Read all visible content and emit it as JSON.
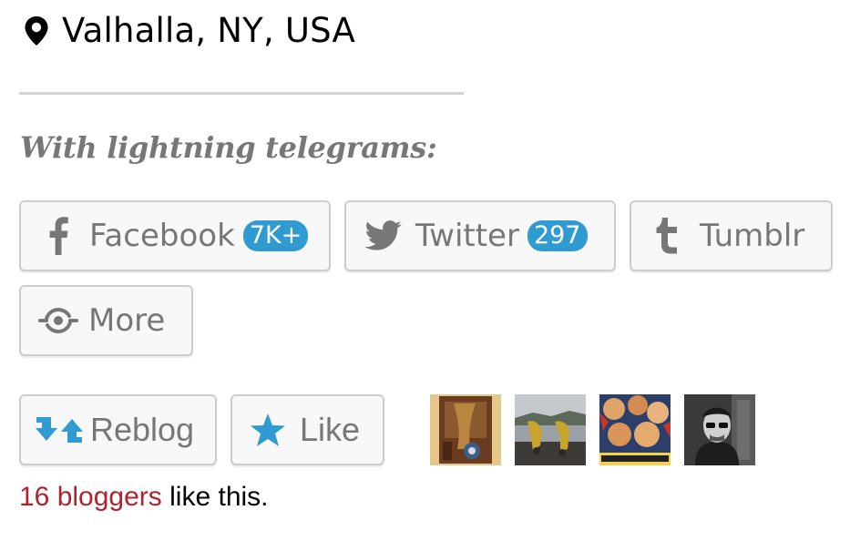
{
  "location": {
    "text": "Valhalla, NY, USA",
    "icon": "map-pin-icon"
  },
  "share": {
    "heading": "With lightning telegrams:",
    "buttons": {
      "facebook": {
        "label": "Facebook",
        "count": "7K+",
        "icon": "facebook-icon"
      },
      "twitter": {
        "label": "Twitter",
        "count": "297",
        "icon": "twitter-bird-icon"
      },
      "tumblr": {
        "label": "Tumblr",
        "icon": "tumblr-icon"
      },
      "more": {
        "label": "More",
        "icon": "share-more-icon"
      }
    }
  },
  "actions": {
    "reblog": {
      "label": "Reblog",
      "icon": "reblog-arrows-icon"
    },
    "like": {
      "label": "Like",
      "icon": "star-icon"
    }
  },
  "likes": {
    "link_text": "16 bloggers",
    "suffix": " like this."
  },
  "colors": {
    "count_badge": "#2f9bd1",
    "reblog_icon": "#2f9bd1",
    "like_star": "#2f9bd1",
    "link_red": "#b0232e",
    "button_text": "#777777",
    "heading": "#777777"
  }
}
